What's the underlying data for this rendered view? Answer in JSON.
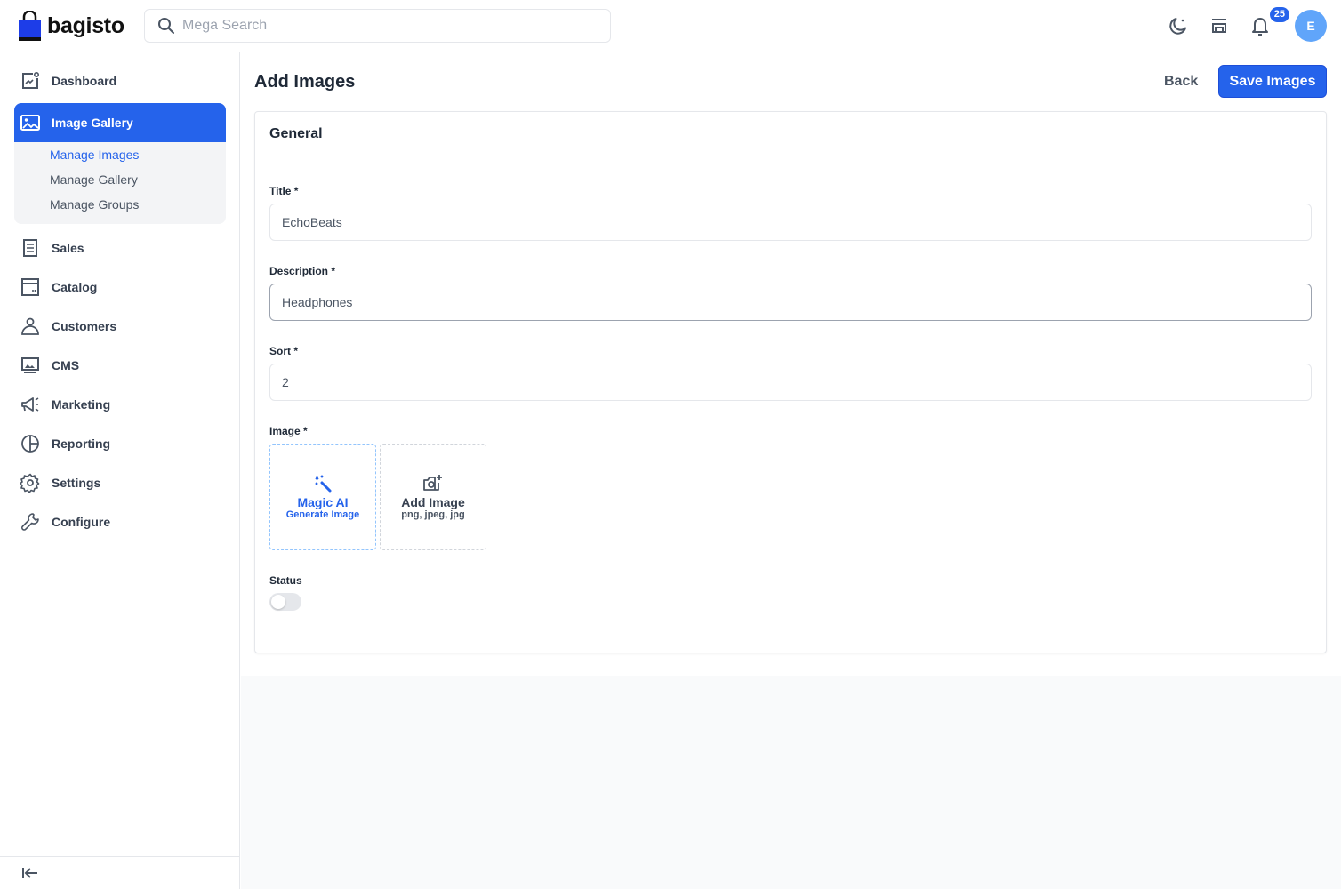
{
  "header": {
    "brand": "bagisto",
    "search_placeholder": "Mega Search",
    "notification_count": "25",
    "avatar_initial": "E",
    "icons": [
      "dark-mode-icon",
      "storefront-icon",
      "bell-icon"
    ]
  },
  "sidebar": {
    "items": [
      {
        "label": "Dashboard",
        "icon": "dashboard-icon"
      },
      {
        "label": "Image Gallery",
        "icon": "image-icon",
        "active": true
      },
      {
        "label": "Sales",
        "icon": "sales-icon"
      },
      {
        "label": "Catalog",
        "icon": "catalog-icon"
      },
      {
        "label": "Customers",
        "icon": "customers-icon"
      },
      {
        "label": "CMS",
        "icon": "cms-icon"
      },
      {
        "label": "Marketing",
        "icon": "megaphone-icon"
      },
      {
        "label": "Reporting",
        "icon": "chart-pie-icon"
      },
      {
        "label": "Settings",
        "icon": "gear-icon"
      },
      {
        "label": "Configure",
        "icon": "wrench-icon"
      }
    ],
    "submenu": [
      {
        "label": "Manage Images",
        "active": true
      },
      {
        "label": "Manage Gallery"
      },
      {
        "label": "Manage Groups"
      }
    ]
  },
  "page": {
    "title": "Add Images",
    "back_label": "Back",
    "save_label": "Save Images"
  },
  "form": {
    "section_title": "General",
    "title_label": "Title *",
    "title_value": "EchoBeats",
    "description_label": "Description *",
    "description_value": "Headphones",
    "sort_label": "Sort *",
    "sort_value": "2",
    "image_label": "Image *",
    "magic_ai_title": "Magic AI",
    "magic_ai_sub": "Generate Image",
    "add_image_title": "Add Image",
    "add_image_sub": "png, jpeg, jpg",
    "status_label": "Status",
    "status_on": false
  },
  "colors": {
    "accent": "#2563eb",
    "avatar": "#60a5fa"
  }
}
